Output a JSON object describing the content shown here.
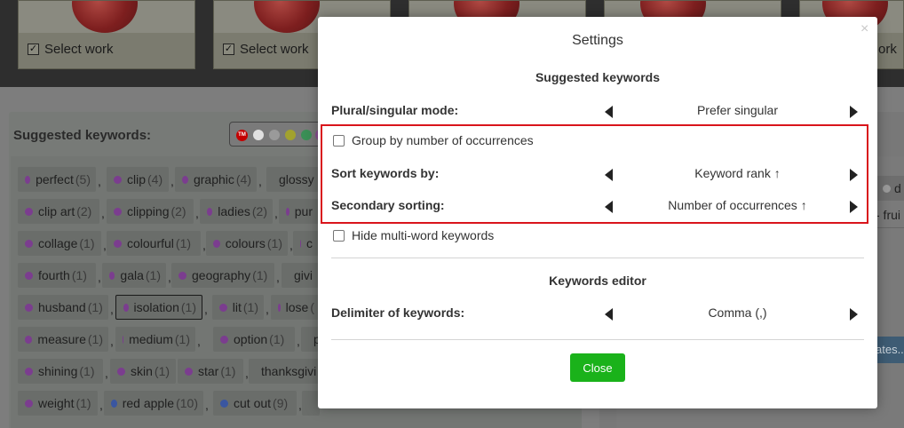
{
  "background": {
    "cards": [
      {
        "label": "Select work"
      },
      {
        "label": "Select work"
      },
      {
        "label": ""
      },
      {
        "label": ""
      },
      {
        "label": "ork"
      }
    ],
    "suggested_label": "Suggested keywords:",
    "swatch_colors": [
      "#c40000",
      "#ffffff",
      "#a0a0a0",
      "#b5b51c",
      "#3aa05a",
      "#9a5aa0"
    ],
    "tm_label": "TM",
    "keywords": [
      {
        "word": "perfect",
        "count": "(5)",
        "color": "#7b3d8f"
      },
      {
        "word": "clip",
        "count": "(4)",
        "color": "#7b3d8f"
      },
      {
        "word": "graphic",
        "count": "(4)",
        "color": "#7b3d8f"
      },
      {
        "word": "glossy",
        "count": "",
        "color": "#7b3d8f"
      },
      {
        "word": "clip art",
        "count": "(2)",
        "color": "#7b3d8f"
      },
      {
        "word": "clipping",
        "count": "(2)",
        "color": "#7b3d8f"
      },
      {
        "word": "ladies",
        "count": "(2)",
        "color": "#7b3d8f"
      },
      {
        "word": "pur",
        "count": "",
        "color": "#7b3d8f"
      },
      {
        "word": "collage",
        "count": "(1)",
        "color": "#7b3d8f"
      },
      {
        "word": "colourful",
        "count": "(1)",
        "color": "#7b3d8f"
      },
      {
        "word": "colours",
        "count": "(1)",
        "color": "#7b3d8f"
      },
      {
        "word": "c",
        "count": "",
        "color": "#7b3d8f"
      },
      {
        "word": "fourth",
        "count": "(1)",
        "color": "#7b3d8f"
      },
      {
        "word": "gala",
        "count": "(1)",
        "color": "#7b3d8f"
      },
      {
        "word": "geography",
        "count": "(1)",
        "color": "#7b3d8f"
      },
      {
        "word": "givi",
        "count": "",
        "color": "#7b3d8f"
      },
      {
        "word": "husband",
        "count": "(1)",
        "color": "#7b3d8f"
      },
      {
        "word": "isolation",
        "count": "(1)",
        "color": "#7b3d8f"
      },
      {
        "word": "lit",
        "count": "(1)",
        "color": "#7b3d8f"
      },
      {
        "word": "lose",
        "count": "(",
        "color": "#7b3d8f"
      },
      {
        "word": "measure",
        "count": "(1)",
        "color": "#7b3d8f"
      },
      {
        "word": "medium",
        "count": "(1)",
        "color": "#7b3d8f"
      },
      {
        "word": "option",
        "count": "(1)",
        "color": "#7b3d8f"
      },
      {
        "word": "p",
        "count": "",
        "color": "#7b3d8f"
      },
      {
        "word": "shining",
        "count": "(1)",
        "color": "#7b3d8f"
      },
      {
        "word": "skin",
        "count": "(1)",
        "color": "#7b3d8f"
      },
      {
        "word": "star",
        "count": "(1)",
        "color": "#7b3d8f"
      },
      {
        "word": "thanksgivi",
        "count": "",
        "color": "#7b3d8f"
      },
      {
        "word": "weight",
        "count": "(1)",
        "color": "#7b3d8f"
      },
      {
        "word": "red apple",
        "count": "(10)",
        "color": "#3a56a0"
      },
      {
        "word": "cut out",
        "count": "(9)",
        "color": "#3a56a0"
      },
      {
        "word": "",
        "count": "",
        "color": "#3a56a0"
      }
    ],
    "right_chip": "d",
    "right_fruit": "- frui",
    "right_button": "ates..."
  },
  "modal": {
    "title": "Settings",
    "close_icon": "×",
    "section_suggested": "Suggested keywords",
    "plural_label": "Plural/singular mode:",
    "plural_value": "Prefer singular",
    "group_label": "Group by number of occurrences",
    "sort_label": "Sort keywords by:",
    "sort_value": "Keyword rank ↑",
    "secondary_label": "Secondary sorting:",
    "secondary_value": "Number of occurrences ↑",
    "hide_label": "Hide multi-word keywords",
    "section_editor": "Keywords editor",
    "delimiter_label": "Delimiter of keywords:",
    "delimiter_value": "Comma (,)",
    "close_button": "Close",
    "accent_color": "#1ab21a",
    "highlight_color": "#d9151c"
  }
}
